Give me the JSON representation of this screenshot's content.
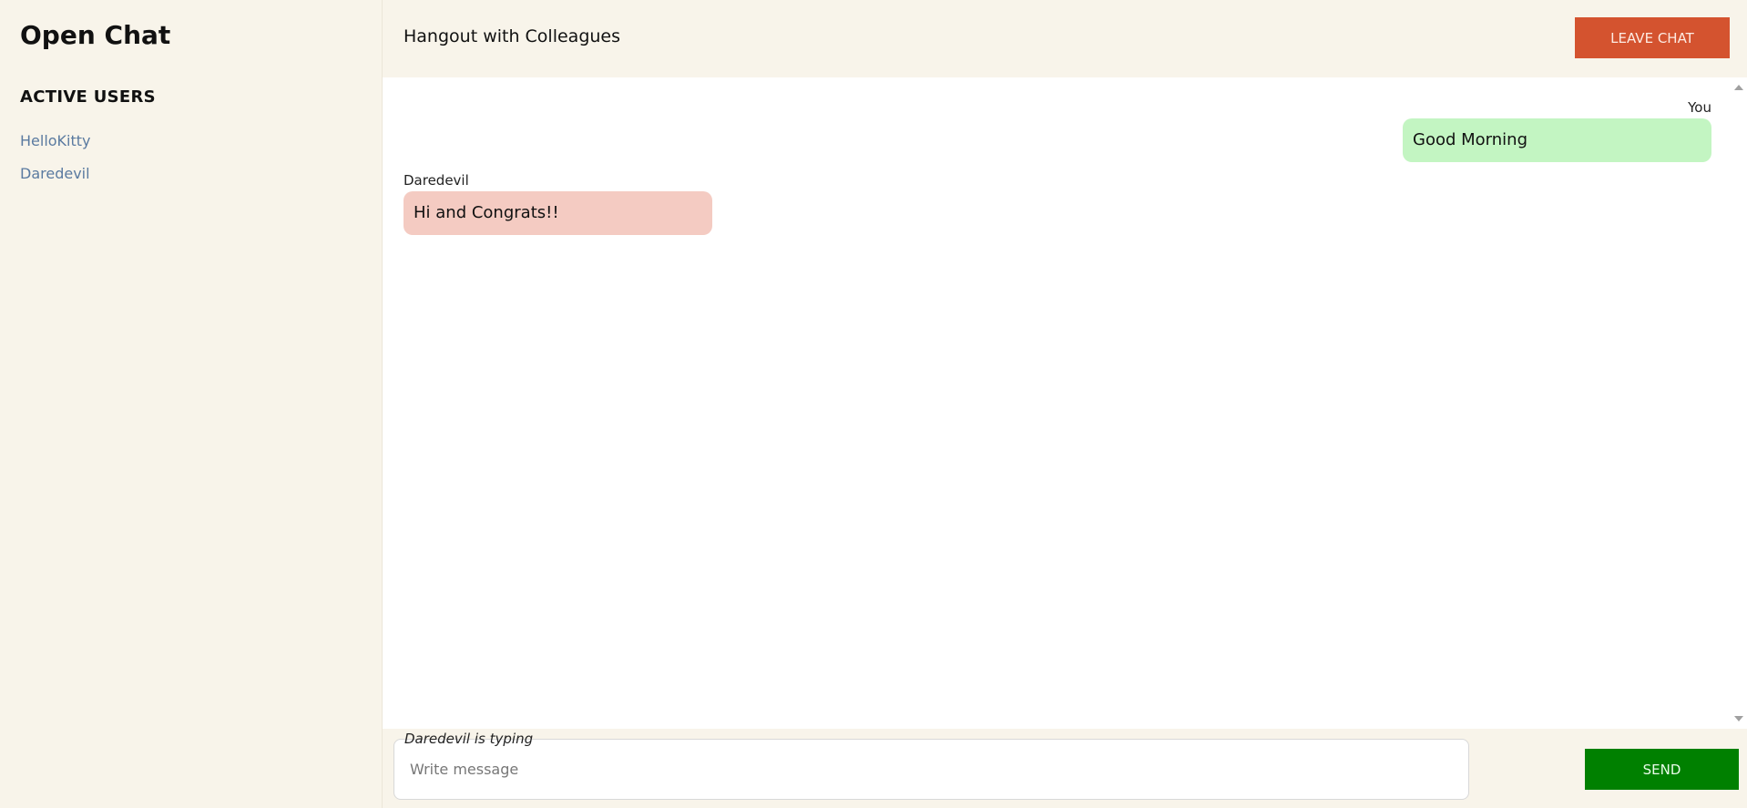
{
  "sidebar": {
    "app_title": "Open Chat",
    "section_title": "ACTIVE USERS",
    "users": [
      {
        "name": "HelloKitty"
      },
      {
        "name": "Daredevil"
      }
    ]
  },
  "header": {
    "room_name": "Hangout with Colleagues",
    "leave_label": "LEAVE CHAT"
  },
  "messages": [
    {
      "sender": "You",
      "text": "Good Morning",
      "mine": true
    },
    {
      "sender": "Daredevil",
      "text": "Hi and Congrats!!",
      "mine": false
    }
  ],
  "composer": {
    "typing_indicator": "Daredevil is typing",
    "placeholder": "Write message",
    "value": "",
    "send_label": "SEND"
  },
  "colors": {
    "background": "#f8f4ea",
    "leave_button": "#d4532f",
    "send_button": "#008000",
    "my_bubble": "#c3f5c2",
    "other_bubble": "#f4cbc2",
    "user_link": "#5a7aa0"
  },
  "icons": {
    "scroll_up": "triangle-up-icon",
    "scroll_down": "triangle-down-icon"
  }
}
